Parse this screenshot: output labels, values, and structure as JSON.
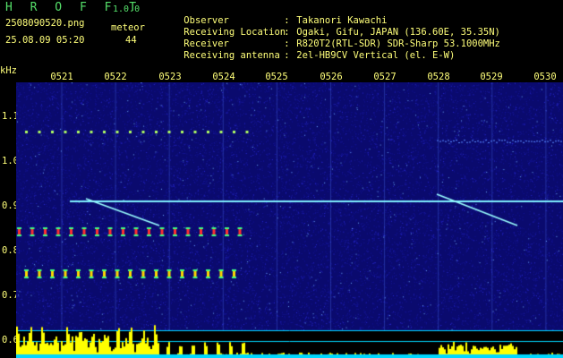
{
  "header": {
    "app_title": "H R O F F T",
    "version": "1.0.0",
    "filename": "2508090520.png",
    "meteor_label": "meteor",
    "datetime": "25.08.09 05:20",
    "meteor_count": "44"
  },
  "info": [
    {
      "key": "Observer",
      "value": "Takanori Kawachi"
    },
    {
      "key": "Receiving Location",
      "value": "Ogaki, Gifu, JAPAN (136.60E, 35.35N)"
    },
    {
      "key": "Receiver",
      "value": "R820T2(RTL-SDR) SDR-Sharp 53.1000MHz"
    },
    {
      "key": "Receiving antenna",
      "value": "2el-HB9CV Vertical (el. E-W)"
    }
  ],
  "axis": {
    "unit": "kHz",
    "x_ticks": [
      "0521",
      "0522",
      "0523",
      "0524",
      "0525",
      "0526",
      "0527",
      "0528",
      "0529",
      "0530"
    ],
    "y_ticks": [
      "1.1",
      "1.0",
      "0.9",
      "0.8",
      "0.7",
      "0.6"
    ]
  },
  "colors": {
    "background": "#000000",
    "plot_background": "#0a0a6e",
    "header_text": "#ffff7a",
    "title_text": "#55e06a",
    "carrier_line": "#7ff0ff",
    "histogram": "#ffff00",
    "baseline": "#00d8ff"
  }
}
